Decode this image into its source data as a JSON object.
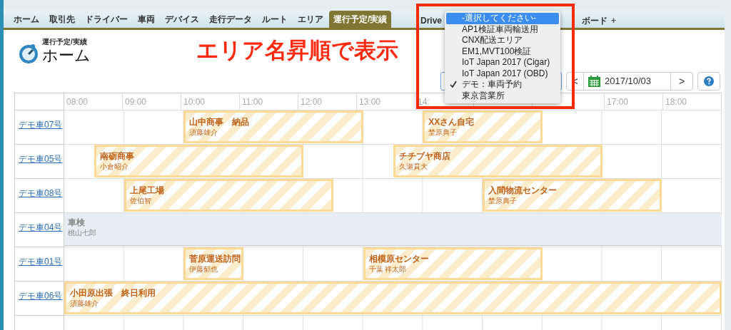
{
  "tabs": [
    {
      "label": "ホーム",
      "selected": false
    },
    {
      "label": "取引先",
      "selected": false
    },
    {
      "label": "ドライバー",
      "selected": false
    },
    {
      "label": "車両",
      "selected": false
    },
    {
      "label": "デバイス",
      "selected": false
    },
    {
      "label": "走行データ",
      "selected": false
    },
    {
      "label": "ルート",
      "selected": false
    },
    {
      "label": "エリア",
      "selected": false
    },
    {
      "label": "運行予定/実績",
      "selected": true
    },
    {
      "label": "Drive",
      "selected": false
    },
    {
      "label": "ボード",
      "selected": false
    },
    {
      "label": "+",
      "selected": false
    }
  ],
  "header": {
    "subtitle": "運行予定/実績",
    "title": "ホーム"
  },
  "annotation": "エリア名昇順で表示",
  "area_dropdown": {
    "options": [
      {
        "label": "-選択してください-",
        "highlighted": true,
        "checked": false
      },
      {
        "label": "AP1検証車両輸送用",
        "highlighted": false,
        "checked": false
      },
      {
        "label": "CNX配送エリア",
        "highlighted": false,
        "checked": false
      },
      {
        "label": "EM1,MVT100検証",
        "highlighted": false,
        "checked": false
      },
      {
        "label": "IoT Japan 2017 (Cigar)",
        "highlighted": false,
        "checked": false
      },
      {
        "label": "IoT Japan 2017 (OBD)",
        "highlighted": false,
        "checked": false
      },
      {
        "label": "デモ：車両予約",
        "highlighted": false,
        "checked": true
      },
      {
        "label": "東京営業所",
        "highlighted": false,
        "checked": false
      }
    ]
  },
  "date_nav": {
    "prev": "<",
    "date": "2017/10/03",
    "next": ">"
  },
  "schedule": {
    "hours": [
      "08:00",
      "09:00",
      "10:00",
      "11:00",
      "12:00",
      "13:00",
      "14:",
      "17:00",
      "18:00"
    ],
    "rows": [
      {
        "vehicle": "デモ車07号",
        "events": [
          {
            "kind": "planned",
            "title": "山中商事　納品",
            "person": "須藤雄介"
          },
          {
            "kind": "planned",
            "title": "XXさん自宅",
            "person": "埜原典子"
          }
        ]
      },
      {
        "vehicle": "デモ車05号",
        "events": [
          {
            "kind": "planned",
            "title": "南砺商事",
            "person": "小倉昭介"
          },
          {
            "kind": "planned",
            "title": "チチブヤ商店",
            "person": "久瀬貫大"
          }
        ]
      },
      {
        "vehicle": "デモ車08号",
        "events": [
          {
            "kind": "planned",
            "title": "上尾工場",
            "person": "佐伯智"
          },
          {
            "kind": "planned",
            "title": "入間物流センター",
            "person": "埜原典子"
          }
        ]
      },
      {
        "vehicle": "デモ車04号",
        "events": [
          {
            "kind": "maintenance",
            "title": "車検",
            "person": "桃山七郎"
          }
        ]
      },
      {
        "vehicle": "デモ車01号",
        "events": [
          {
            "kind": "planned",
            "title": "菅原運送訪問",
            "person": "伊藤郁也"
          },
          {
            "kind": "planned",
            "title": "相模原センター",
            "person": "千葉 祥太郎"
          }
        ]
      },
      {
        "vehicle": "デモ車06号",
        "events": [
          {
            "kind": "planned",
            "title": "小田原出張　終日利用",
            "person": "須藤雄介"
          }
        ]
      }
    ]
  }
}
